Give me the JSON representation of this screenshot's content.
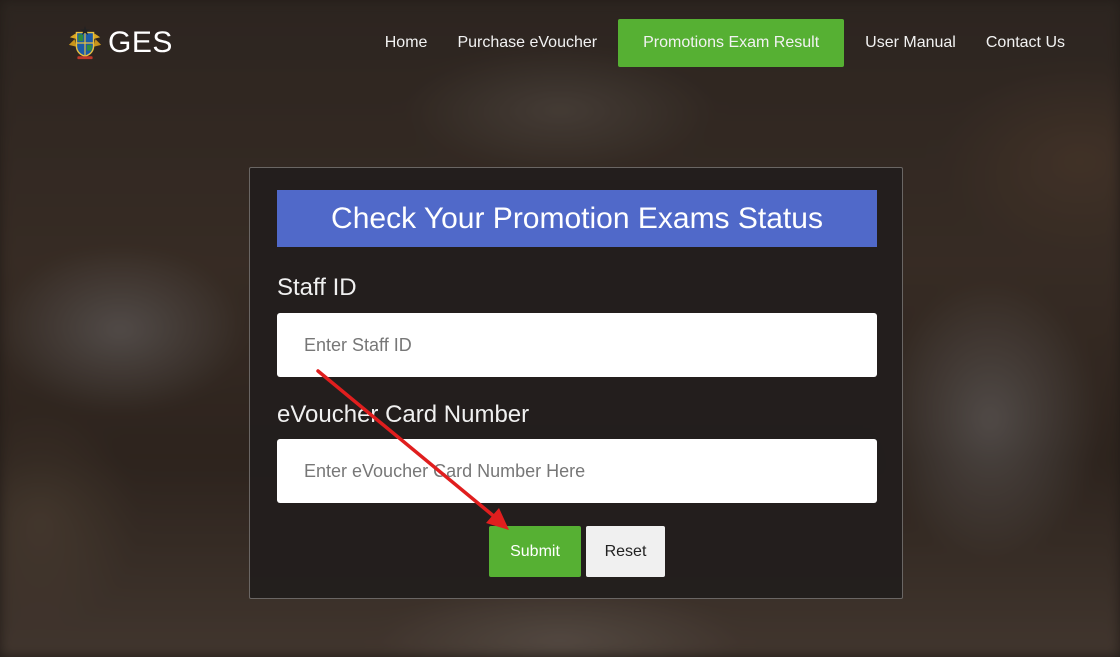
{
  "header": {
    "logo_text": "GES"
  },
  "nav": {
    "items": [
      {
        "label": "Home"
      },
      {
        "label": "Purchase eVoucher"
      },
      {
        "label": "Promotions Exam Result"
      },
      {
        "label": "User Manual"
      },
      {
        "label": "Contact Us"
      }
    ],
    "active_index": 2
  },
  "form": {
    "title": "Check Your Promotion Exams Status",
    "staff_id": {
      "label": "Staff ID",
      "placeholder": "Enter Staff ID",
      "value": ""
    },
    "voucher": {
      "label": "eVoucher Card Number",
      "placeholder": "Enter eVoucher Card Number Here",
      "value": ""
    },
    "submit_label": "Submit",
    "reset_label": "Reset"
  },
  "colors": {
    "accent_green": "#56b033",
    "title_blue": "#5069c9",
    "panel_bg": "#221e1d",
    "annotation_red": "#e01e1e"
  },
  "icons": {
    "logo": "ghana-coat-of-arms-icon",
    "annotation": "red-arrow-pointing-to-submit"
  }
}
